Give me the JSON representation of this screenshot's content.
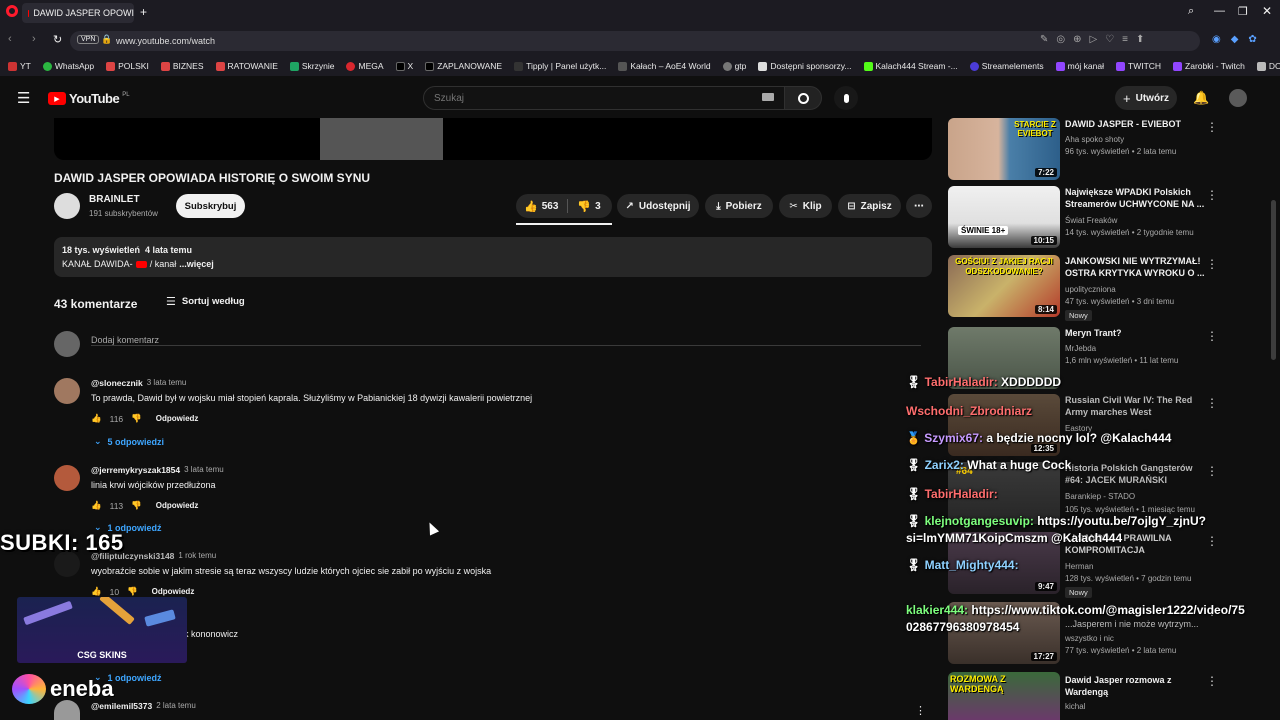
{
  "browser": {
    "tab_title": "DAWID JASPER OPOWI",
    "url": "www.youtube.com/watch",
    "vpn": "VPN",
    "bookmarks": [
      "YT",
      "WhatsApp",
      "POLSKI",
      "BIZNES",
      "RATOWANIE",
      "Skrzynie",
      "MEGA",
      "X",
      "ZAPLANOWANE",
      "Tipply | Panel użytk...",
      "Kałach – AoE4 World",
      "gtp",
      "Dostępni sponsorzy...",
      "Kalach444 Stream -...",
      "Streamelements",
      "mój kanał",
      "TWITCH",
      "Zarobki - Twitch",
      "DOM"
    ]
  },
  "yt": {
    "logo": "YouTube",
    "region": "PL",
    "search_placeholder": "Szukaj",
    "create_label": "Utwórz"
  },
  "video": {
    "title": "DAWID JASPER OPOWIADA HISTORIĘ O SWOIM SYNU",
    "channel": "BRAINLET",
    "subscribers": "191 subskrybentów",
    "subscribe_label": "Subskrybuj",
    "likes": "563",
    "dislikes": "3",
    "share_label": "Udostępnij",
    "download_label": "Pobierz",
    "clip_label": "Klip",
    "save_label": "Zapisz",
    "views_time": "18 tys. wyświetleń  4 lata temu",
    "desc_prefix": "KANAŁ DAWIDA-",
    "desc_link": "/ kanał",
    "desc_more": "...więcej"
  },
  "comments": {
    "count_label": "43 komentarze",
    "sort_label": "Sortuj według",
    "add_placeholder": "Dodaj komentarz",
    "reply_label": "Odpowiedz",
    "items": [
      {
        "user": "@slonecznik",
        "time": "3 lata temu",
        "text": "To prawda, Dawid był w wojsku miał stopień kaprala. Służyliśmy w Pabianickiej 18 dywizji kawalerii powietrznej",
        "likes": "116",
        "replies": "5 odpowiedzi"
      },
      {
        "user": "@jerremykryszak1854",
        "time": "3 lata temu",
        "text": "linia krwi wójcików przedłużona",
        "likes": "113",
        "replies": "1 odpowiedź"
      },
      {
        "user": "@filiptulczynski3148",
        "time": "1 rok temu",
        "text": "wyobraźcie sobie w jakim stresie są teraz wszyscy ludzie których ojciec sie zabił po wyjściu z wojska",
        "likes": "10",
        "replies": ""
      },
      {
        "user": "",
        "time": "",
        "text": "k kononowicz",
        "likes": "",
        "replies": "1 odpowiedź"
      },
      {
        "user": "@emilemil5373",
        "time": "2 lata temu",
        "text": "",
        "likes": "",
        "replies": ""
      }
    ]
  },
  "sidebar": [
    {
      "title": "DAWID JASPER - EVIEBOT",
      "channel": "Aha spoko shoty",
      "meta": "96 tys. wyświetleń • 2 lata temu",
      "duration": "7:22",
      "badge": "",
      "thumb_text": "STARCIE Z EVIEBOT"
    },
    {
      "title": "Największe WPADKI Polskich Streamerów UCHWYCONE NA ...",
      "channel": "Świat Freaków",
      "meta": "14 tys. wyświetleń • 2 tygodnie temu",
      "duration": "10:15",
      "badge": "",
      "thumb_text": "ŚWINIE 18+"
    },
    {
      "title": "JANKOWSKI NIE WYTRZYMAŁ! OSTRA KRYTYKA WYROKU O ...",
      "channel": "upolityczniona",
      "meta": "47 tys. wyświetleń • 3 dni temu",
      "duration": "8:14",
      "badge": "Nowy",
      "thumb_text": "GOŚCIU! Z JAKIEJ RACJI ODSZKODOWANIE?"
    },
    {
      "title": "Meryn Trant?",
      "channel": "MrJebda",
      "meta": "1,6 mln wyświetleń • 11 lat temu",
      "duration": "",
      "badge": "",
      "thumb_text": ""
    },
    {
      "title": "Russian Civil War IV: The Red Army marches West",
      "channel": "Eastory",
      "meta": "",
      "duration": "12:35",
      "badge": "",
      "thumb_text": ""
    },
    {
      "title": "Historia Polskich Gangsterów #64: JACEK MURAŃSKI",
      "channel": "Barankiep - STADO",
      "meta": "105 tys. wyświetleń • 1 miesiąc temu",
      "duration": "",
      "badge": "",
      "thumb_text": "#64"
    },
    {
      "title": "...I SANDRA - PRAWILNA KOMPROMITACJA",
      "channel": "Herman",
      "meta": "128 tys. wyświetleń • 7 godzin temu",
      "duration": "9:47",
      "badge": "Nowy",
      "thumb_text": ""
    },
    {
      "title": "...Jasperem i nie może wytrzym...",
      "channel": "wszystko i nic",
      "meta": "77 tys. wyświetleń • 2 lata temu",
      "duration": "17:27",
      "badge": "",
      "thumb_text": ""
    },
    {
      "title": "Dawid Jasper rozmowa z Wardengą",
      "channel": "kichal",
      "meta": "",
      "duration": "",
      "badge": "",
      "thumb_text": "ROZMOWA Z WARDENGĄ"
    }
  ],
  "overlay": {
    "subs_label": "SUBKI: 165",
    "sponsor_csgo": "CSG SKINS",
    "sponsor_eneba": "eneba",
    "chat": [
      {
        "user": "TabirHaladir:",
        "msg": "XDDDDDD"
      },
      {
        "user": "Wschodni_Zbrodniarz",
        "msg": ""
      },
      {
        "user": "Szymix67:",
        "msg": "a będzie nocny lol? @Kalach444"
      },
      {
        "user": "Zarix2:",
        "msg": "What a huge Cock"
      },
      {
        "user": "TabirHaladir:",
        "msg": ""
      },
      {
        "user": "klejnotgangesuvip:",
        "msg": "https://youtu.be/7ojlgY_zjnU?"
      },
      {
        "user": "",
        "msg": "si=lmYMM71KoipCmszm @Kalach444"
      },
      {
        "user": "Matt_Mighty444:",
        "msg": ""
      },
      {
        "user": "klakier444:",
        "msg": "https://www.tiktok.com/@magisler1222/video/75"
      },
      {
        "user": "",
        "msg": "0286779638097845​4"
      }
    ]
  },
  "colors": {
    "bg": "#0f0f0f",
    "pill": "#272727",
    "link": "#3ea6ff",
    "yt_red": "#ff0000"
  }
}
